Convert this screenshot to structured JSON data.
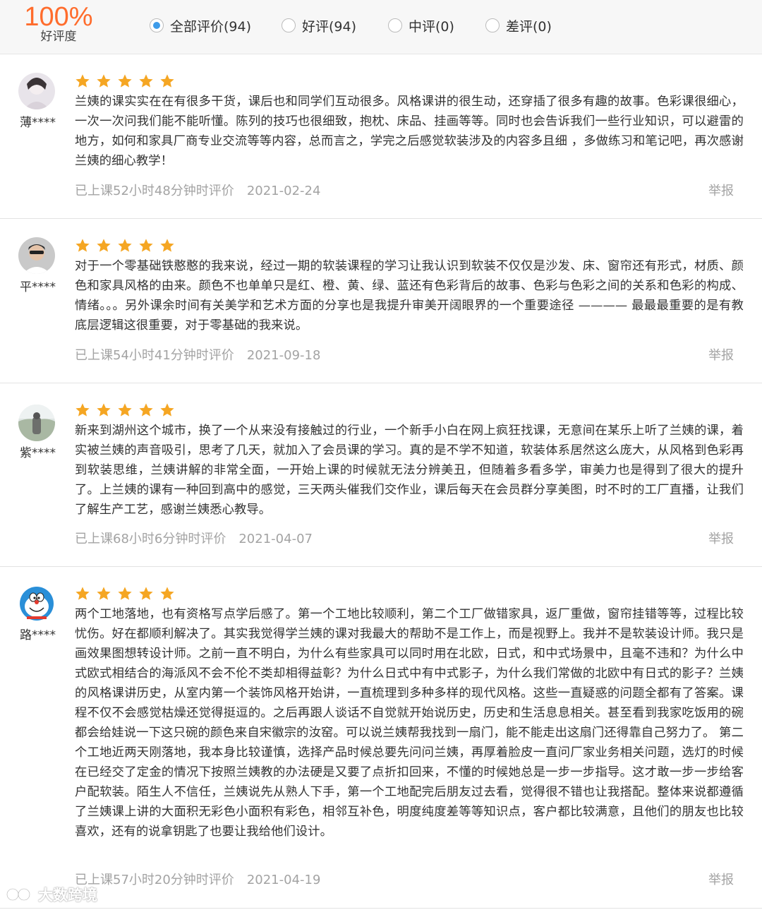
{
  "summary": {
    "percentage": "100%",
    "label": "好评度"
  },
  "filters": [
    {
      "label": "全部评价(94)",
      "checked": true
    },
    {
      "label": "好评(94)",
      "checked": false
    },
    {
      "label": "中评(0)",
      "checked": false
    },
    {
      "label": "差评(0)",
      "checked": false
    }
  ],
  "reviews": [
    {
      "username": "薄****",
      "stars": 5,
      "text": "兰姨的课实实在在有很多干货，课后也和同学们互动很多。风格课讲的很生动，还穿插了很多有趣的故事。色彩课很细心，一次一次问我们能不能听懂。陈列的技巧也很细致，抱枕、床品、挂画等等。同时也会告诉我们一些行业知识，可以避雷的地方，如何和家具厂商专业交流等等内容，总而言之，学完之后感觉软装涉及的内容多且细 ，多做练习和笔记吧，再次感谢兰姨的细心教学！",
      "study_time": "已上课52小时48分钟时评价",
      "date": "2021-02-24",
      "report": "举报"
    },
    {
      "username": "平****",
      "stars": 5,
      "text": " 对于一个零基础铁憨憨的我来说，经过一期的软装课程的学习让我认识到软装不仅仅是沙发、床、窗帘还有形式，材质、颜色和家具风格的由来。颜色不也单单只是红、橙、黄、绿、蓝还有色彩背后的故事、色彩与色彩之间的关系和色彩的构成、情绪。。。另外课余时间有关美学和艺术方面的分享也是我提升审美开阔眼界的一个重要途径 ———— 最最最重要的是有教底层逻辑这很重要，对于零基础的我来说。",
      "study_time": "已上课54小时41分钟时评价",
      "date": "2021-09-18",
      "report": "举报"
    },
    {
      "username": "紫****",
      "stars": 5,
      "text": "新来到湖州这个城市，换了一个从来没有接触过的行业，一个新手小白在网上疯狂找课，无意间在某乐上听了兰姨的课，着实被兰姨的声音吸引，思考了几天，就加入了会员课的学习。真的是不学不知道，软装体系居然这么庞大，从风格到色彩再到软装思维，兰姨讲解的非常全面，一开始上课的时候就无法分辨美丑，但随着多看多学，审美力也是得到了很大的提升了。上兰姨的课有一种回到高中的感觉，三天两头催我们交作业，课后每天在会员群分享美图，时不时的工厂直播，让我们了解生产工艺，感谢兰姨悉心教导。",
      "study_time": "已上课68小时6分钟时评价",
      "date": "2021-04-07",
      "report": "举报"
    },
    {
      "username": "路****",
      "stars": 5,
      "text": "两个工地落地，也有资格写点学后感了。第一个工地比较顺利，第二个工厂做错家具，返厂重做，窗帘挂错等等，过程比较忧伤。好在都顺利解决了。其实我觉得学兰姨的课对我最大的帮助不是工作上，而是视野上。我并不是软装设计师。我只是画效果图想转设计师。之前一直不明白，为什么有些家具可以同时用在北欧，日式，和中式场景中，且毫不违和？为什么中式欧式相结合的海派风不会不伦不类却相得益彰？为什么日式中有中式影子，为什么我们常做的北欧中有日式的影子？兰姨的风格课讲历史，从室内第一个装饰风格开始讲，一直梳理到多种多样的现代风格。这些一直疑惑的问题全都有了答案。课程不仅不会感觉枯燥还觉得挺逗的。之后再跟人谈话不自觉就开始说历史，历史和生活息息相关。甚至看到我家吃饭用的碗都会给娃说一下这只碗的颜色来自宋徽宗的汝窑。可以说兰姨帮我找到一扇门，能不能走出这扇门还得靠自己努力了。 第二个工地近两天刚落地，我本身比较谨慎，选择产品时候总要先问问兰姨，再厚着脸皮一直问厂家业务相关问题，选灯的时候在已经交了定金的情况下按照兰姨教的办法硬是又要了点折扣回来，不懂的时候她总是一步一步指导。这才敢一步一步给客户配软装。陌生人不信任，兰姨说先从熟人下手，第一个工地配完后朋友过去看，觉得很不错也让我搭配。整体来说都遵循了兰姨课上讲的大面积无彩色小面积有彩色，相邻互补色，明度纯度差等等知识点，客户都比较满意，且他们的朋友也比较喜欢，还有的说拿钥匙了也要让我给他们设计。",
      "study_time": "已上课57小时20分钟时评价",
      "date": "2021-04-19",
      "report": "举报"
    }
  ],
  "watermark": {
    "text": "大数跨境"
  },
  "colors": {
    "accent_orange": "#ff6c2c",
    "radio_blue": "#3d9be9",
    "star": "#f5a623",
    "meta_gray": "#a3a3a3"
  }
}
